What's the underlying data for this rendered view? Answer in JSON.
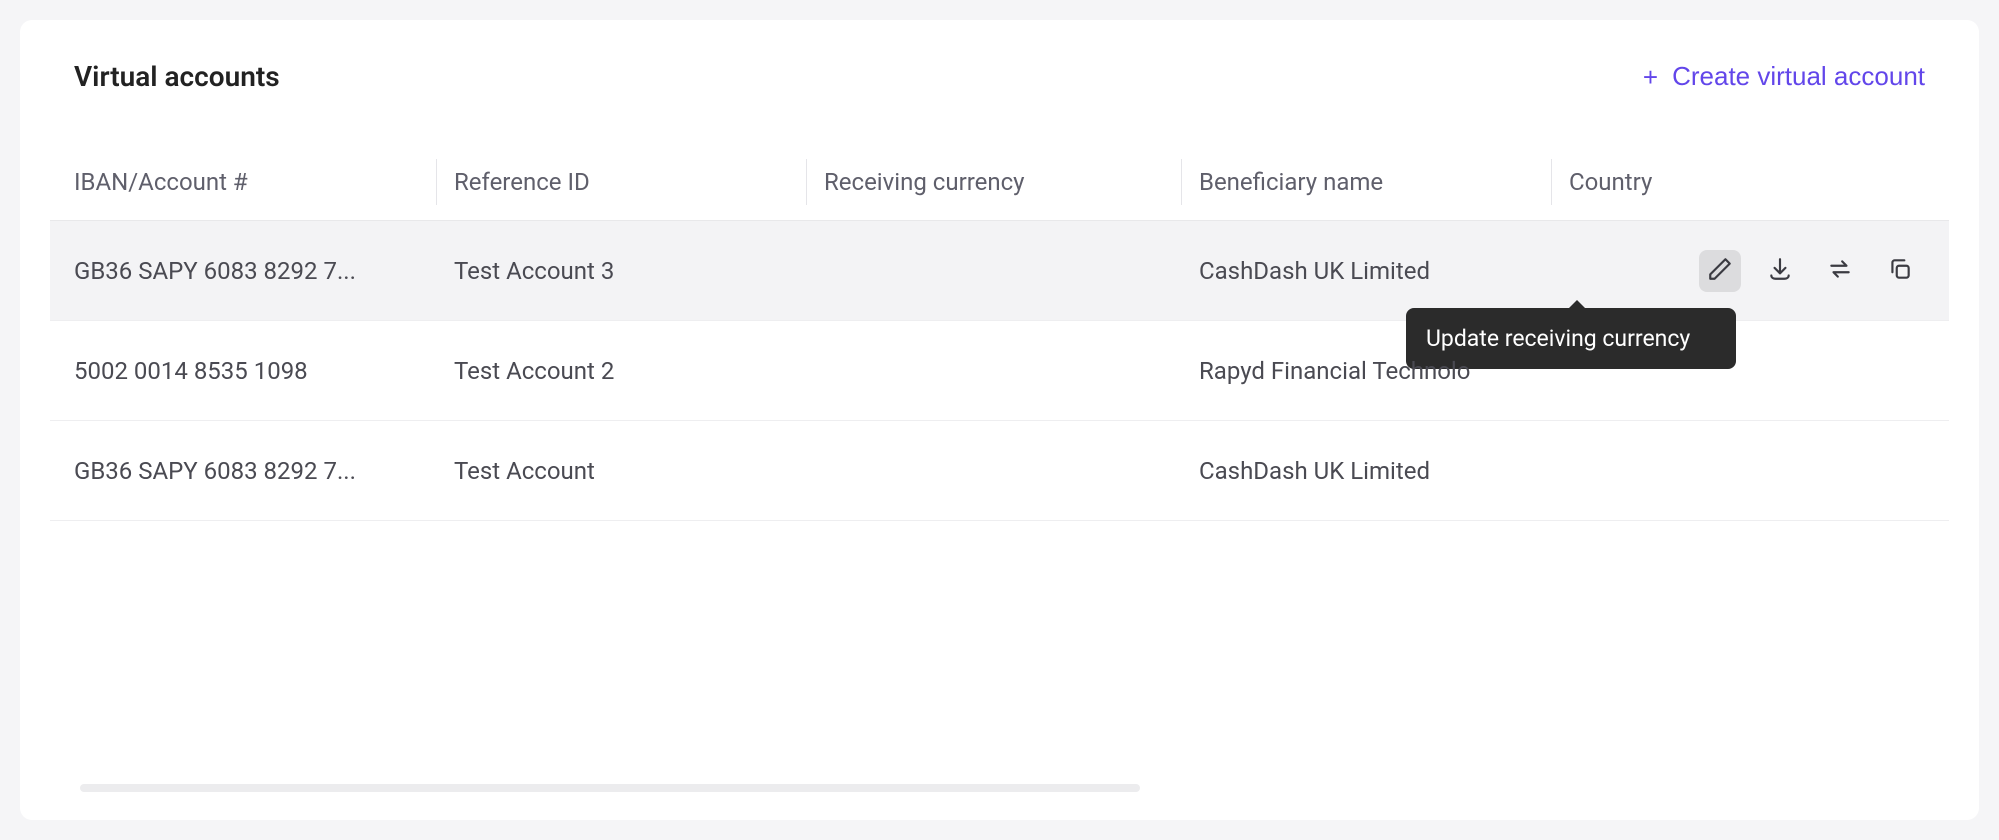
{
  "page": {
    "title": "Virtual accounts",
    "create_button": "Create virtual account"
  },
  "columns": {
    "iban": "IBAN/Account #",
    "reference": "Reference ID",
    "currency": "Receiving currency",
    "beneficiary": "Beneficiary name",
    "country": "Country"
  },
  "rows": [
    {
      "iban": "GB36 SAPY 6083 8292 7...",
      "reference": "Test Account 3",
      "currency": "",
      "beneficiary": "CashDash UK Limited",
      "country": ""
    },
    {
      "iban": "5002 0014 8535 1098",
      "reference": "Test Account 2",
      "currency": "",
      "beneficiary": "Rapyd Financial Technolo",
      "country": ""
    },
    {
      "iban": "GB36 SAPY 6083 8292 7...",
      "reference": "Test Account",
      "currency": "",
      "beneficiary": "CashDash UK Limited",
      "country": ""
    }
  ],
  "actions": {
    "edit_tooltip": "Update receiving currency"
  },
  "icons": {
    "plus": "plus-icon",
    "edit": "pencil-icon",
    "download": "download-icon",
    "transfer": "transfer-icon",
    "copy": "copy-icon"
  }
}
